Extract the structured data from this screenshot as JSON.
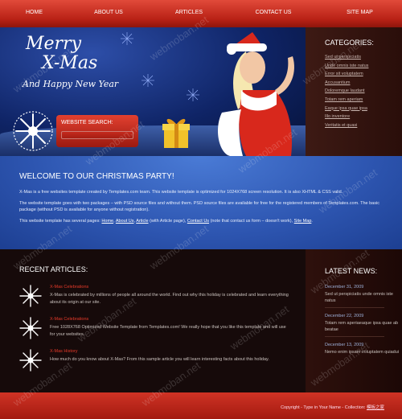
{
  "nav": {
    "items": [
      "HOME",
      "ABOUT US",
      "ARTICLES",
      "CONTACT US",
      "SITE MAP"
    ]
  },
  "hero": {
    "title_line1": "Merry",
    "title_line2": "X-Mas",
    "title_line3": "And Happy New Year",
    "search_label": "WEBSITE SEARCH:",
    "search_value": ""
  },
  "categories": {
    "title": "CATEGORIES:",
    "items": [
      "Sed ut perspiciatis",
      "Unde omnis iste natus",
      "Error sit voluptatem",
      "Accusantium",
      "Doloremque laudant",
      "Totam rem aperiam",
      "Eaque ipsa quae ipsa",
      "Illo inventore",
      "Veritatis et quasi"
    ]
  },
  "welcome": {
    "title": "WELCOME TO OUR CHRISTMAS PARTY!",
    "p1": "X-Mas is a free websites template created by Templates.com team. This website template is optimized for 1024X768 screen resolution. It is also XHTML & CSS valid.",
    "p2": "The website template goes with two packages – with PSD source files and without them. PSD source files are available for free for the registered members of Templates.com. The basic package (without PSD is available for anyone without registration).",
    "p3_prefix": "This website template has several pages:",
    "p3_links": {
      "home": "Home",
      "about": "About Us",
      "article": "Article",
      "contact": "Contact Us",
      "sitemap": "Site Map"
    },
    "p3_article_note": "(with Article page),",
    "p3_contact_note": "(note that contact us form – doesn't work),",
    "p3_end": "."
  },
  "recent": {
    "title": "RECENT ARTICLES:",
    "articles": [
      {
        "title": "X-Mas Celebrations",
        "text": "X-Mas is celebrated by millions of people all around the world. Find out why this holiday is celebrated and learn everything about its origin at our site."
      },
      {
        "title": "X-Mas Celebrations",
        "text": "Free 1028X768 Optimized Website Template from Templates.com! We really hope that you like this template and will use for your websites."
      },
      {
        "title": "X-Mas History",
        "text": "How much do you know about X-Mas? From this sample article you will learn interesting facts about this holiday."
      }
    ]
  },
  "news": {
    "title": "LATEST NEWS:",
    "items": [
      {
        "date": "December 31, 2009",
        "text": "Sed ut perspiciatis unde omnis iste natus"
      },
      {
        "date": "December 22, 2009",
        "text": "Totam rem aperiaeaque ipsa quae ab beatae"
      },
      {
        "date": "December 13, 2009",
        "text": "Nemo enim ipsam voluptatem quiadui"
      }
    ]
  },
  "footer": {
    "text": "Copyright - Type in Your Name - Collection:",
    "link": "模板之家"
  },
  "watermark": "webmoban.net",
  "colors": {
    "accent_red": "#c22a1c",
    "hero_blue": "#0f2466",
    "welcome_blue": "#2d55b0",
    "dark_bg": "#160a0a"
  }
}
